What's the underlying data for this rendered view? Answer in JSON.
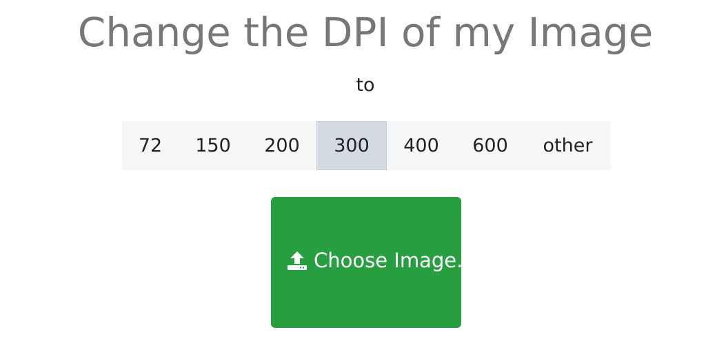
{
  "header": {
    "title": "Change the DPI of my Image",
    "subtitle": "to"
  },
  "dpi_options": {
    "items": [
      {
        "label": "72",
        "selected": false
      },
      {
        "label": "150",
        "selected": false
      },
      {
        "label": "200",
        "selected": false
      },
      {
        "label": "300",
        "selected": true
      },
      {
        "label": "400",
        "selected": false
      },
      {
        "label": "600",
        "selected": false
      },
      {
        "label": "other",
        "selected": false
      }
    ]
  },
  "upload": {
    "label": "Choose Image..",
    "icon": "upload-icon",
    "color": "#279e3f"
  },
  "colors": {
    "title": "#777777",
    "selected_bg": "#d4dbe3",
    "bar_bg": "#f6f7f9"
  }
}
